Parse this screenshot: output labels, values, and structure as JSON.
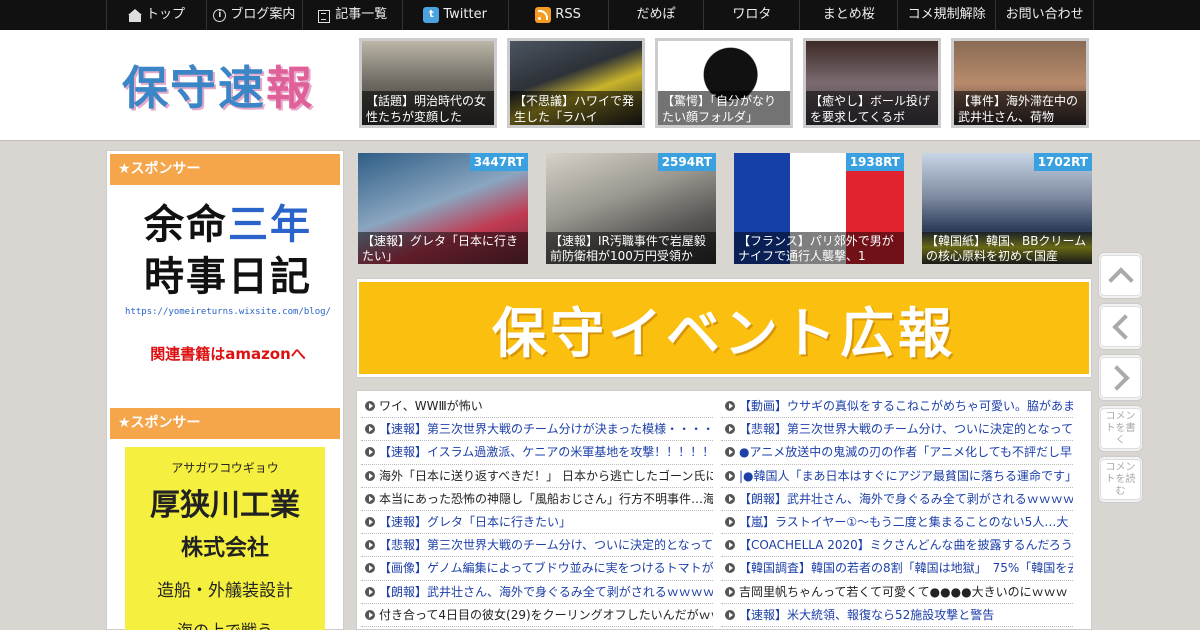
{
  "nav": {
    "items": [
      {
        "label": "トップ",
        "icon": "home-icon"
      },
      {
        "label": "ブログ案内",
        "icon": "info-icon"
      },
      {
        "label": "記事一覧",
        "icon": "list-icon"
      },
      {
        "label": "Twitter",
        "icon": "twitter-icon"
      },
      {
        "label": "RSS",
        "icon": "rss-icon"
      },
      {
        "label": "だめぽ"
      },
      {
        "label": "ワロタ"
      },
      {
        "label": "まとめ桜"
      },
      {
        "label": "コメ規制解除"
      },
      {
        "label": "お問い合わせ"
      }
    ]
  },
  "header": {
    "logo_part1": "保守",
    "logo_part2": "速",
    "logo_part3": "報",
    "thumbs": [
      {
        "caption": "【話題】明治時代の女性たちが変顔した"
      },
      {
        "caption": "【不思議】ハワイで発生した「ラハイ"
      },
      {
        "caption": "【驚愕】「自分がなりたい顔フォルダ」"
      },
      {
        "caption": "【癒やし】ボール投げを要求してくるボ"
      },
      {
        "caption": "【事件】海外滞在中の武井壮さん、荷物"
      }
    ]
  },
  "sidebar": {
    "sponsor1": "★スポンサー",
    "ad1": {
      "line1_a": "余命",
      "line1_b": "三年",
      "line2": "時事日記",
      "url": "https://yomeireturns.wixsite.com/blog/",
      "amazon": "関連書籍はamazonへ"
    },
    "sponsor2": "★スポンサー",
    "ad2": {
      "kana": "アサガワコウギョウ",
      "name": "厚狭川工業",
      "kk": "株式会社",
      "biz": "造船・外艤装設計",
      "more": "海の上で戦う"
    }
  },
  "ranking": [
    {
      "rt": "3447RT",
      "caption": "【速報】グレタ「日本に行きたい」"
    },
    {
      "rt": "2594RT",
      "caption": "【速報】IR汚職事件で岩屋毅前防衛相が100万円受領か"
    },
    {
      "rt": "1938RT",
      "caption": "【フランス】パリ郊外で男がナイフで通行人襲撃、1"
    },
    {
      "rt": "1702RT",
      "caption": "【韓国紙】韓国、BBクリームの核心原料を初めて国産"
    }
  ],
  "banner": {
    "text": "保守イベント広報"
  },
  "list_left": [
    "ワイ、WWⅢが怖い",
    "【速報】第三次世界大戦のチーム分けが決まった模様・・・・",
    "【速報】イスラム過激派、ケニアの米軍基地を攻撃！！！！！",
    "海外「日本に送り返すべきだ！」 日本から逃亡したゴーン氏に",
    "本当にあった恐怖の神隠し「風船おじさん」行方不明事件…海",
    "【速報】グレタ「日本に行きたい」",
    "【悲報】第三次世界大戦のチーム分け、ついに決定的となって",
    "【画像】ゲノム編集によってブドウ並みに実をつけるトマトが",
    "【朗報】武井壮さん、海外で身ぐるみ全て剥がされるｗｗｗｗ",
    "付き合って4日目の彼女(29)をクーリングオフしたいんだがｗｗ"
  ],
  "list_right": [
    "【動画】ウサギの真似をするこねこがめちゃ可愛い。脇があま",
    "【悲報】第三次世界大戦のチーム分け、ついに決定的となって",
    "●アニメ放送中の鬼滅の刃の作者「アニメ化しても不評だし早",
    "|●韓国人「まあ日本はすぐにアジア最貧国に落ちる運命です」",
    "【朗報】武井壮さん、海外で身ぐるみ全て剥がされるｗｗｗｗ",
    "【嵐】ラストイヤー①～もう二度と集まることのない5人…大",
    "【COACHELLA 2020】ミクさんどんな曲を披露するんだろうね",
    "【韓国調査】韓国の若者の8割「韓国は地獄」　75%「韓国を去",
    "吉岡里帆ちゃんって若くて可愛くて●●●●大きいのにｗｗｗ",
    "【速報】米大統領、報復なら52施設攻撃と警告"
  ],
  "side_buttons": {
    "comment_write": "コメントを書く",
    "comment_read": "コメントを読む"
  }
}
